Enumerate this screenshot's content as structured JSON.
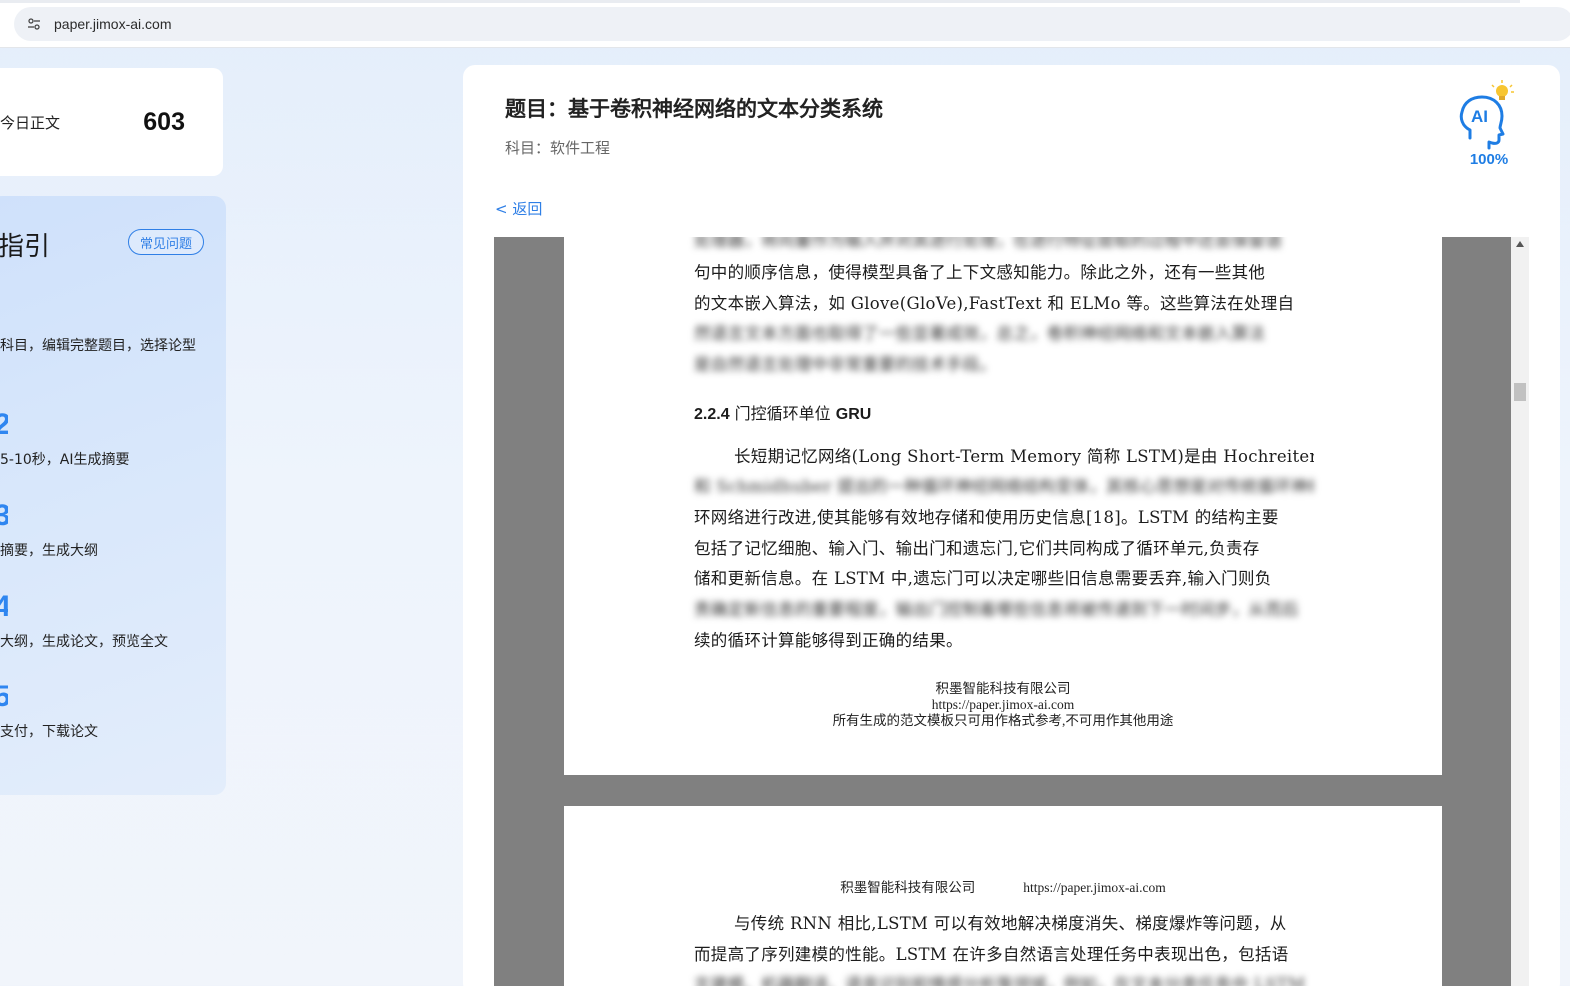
{
  "browser": {
    "url": "paper.jimox-ai.com",
    "site_icon": "site-settings-icon"
  },
  "stats": {
    "label": "今日正文",
    "value": "603"
  },
  "guide": {
    "title": "指引",
    "faq_label": "常见问题",
    "steps": [
      {
        "num": "",
        "desc": "科目，编辑完整题目，选择论型"
      },
      {
        "num": "2",
        "desc": "5-10秒，AI生成摘要"
      },
      {
        "num": "3",
        "desc": "摘要，生成大纲"
      },
      {
        "num": "4",
        "desc": "大纲，生成论文，预览全文"
      },
      {
        "num": "5",
        "desc": "支付，下载论文"
      }
    ]
  },
  "paper": {
    "title": "题目：基于卷积神经网络的文本分类系统",
    "subject": "科目：软件工程",
    "back_label": "< 返回",
    "ai_label": "AI",
    "ai_percent": "100%"
  },
  "document": {
    "page1": {
      "lines_top": [
        "处理器，将向量作为输入并对其进行处理，在进行特征提取的过程中还会保留语",
        "句中的顺序信息，使得模型具备了上下文感知能力。除此之外，还有一些其他",
        "的文本嵌入算法，如 Glove(GloVe),FastText 和 ELMo 等。这些算法在处理自",
        "然语言文本方面也取得了一些显著成效，总之，卷积神经网络和文本嵌入算法",
        "是自然语言处理中非常重要的技术手段。"
      ],
      "heading_num": "2.2.4",
      "heading_text": " 门控循环单位 ",
      "heading_suffix": "GRU",
      "lines_body": [
        "长短期记忆网络(Long Short-Term Memory 简称 LSTM)是由 Hochreiter",
        "和 Schmidhuber 提出的一种循环神经网络结构变体，其核心思想是对传统循环神经",
        "环网络进行改进,使其能够有效地存储和使用历史信息[18]。LSTM 的结构主要",
        "包括了记忆细胞、输入门、输出门和遗忘门,它们共同构成了循环单元,负责存",
        "储和更新信息。在 LSTM 中,遗忘门可以决定哪些旧信息需要丢弃,输入门则负",
        "责确定新信息的重要程度，输出门控制着哪些信息将被传递到下一时间步，从而后",
        "续的循环计算能够得到正确的结果。"
      ],
      "footer": [
        "积墨智能科技有限公司",
        "https://paper.jimox-ai.com",
        "所有生成的范文模板只可用作格式参考,不可用作其他用途"
      ]
    },
    "page2": {
      "header_company": "积墨智能科技有限公司",
      "header_url": "https://paper.jimox-ai.com",
      "lines": [
        "与传统 RNN 相比,LSTM 可以有效地解决梯度消失、梯度爆炸等问题，从",
        "而提高了序列建模的性能。LSTM 在许多自然语言处理任务中表现出色，包括语",
        "言建模、机器翻译、语音识别和情感分析等领域，例如，在文本分类任务中 LSTM"
      ]
    }
  },
  "colors": {
    "accent": "#2f7fe6",
    "viewer_bg": "#808080"
  }
}
